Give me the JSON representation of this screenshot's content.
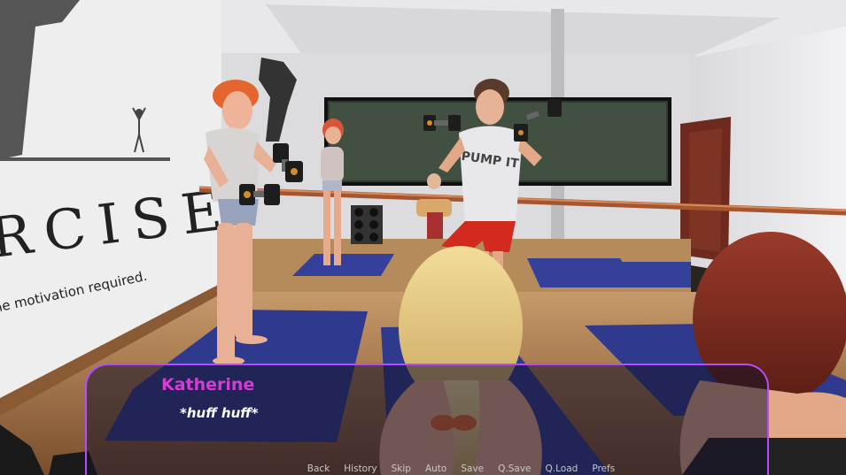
{
  "dialogue": {
    "speaker": "Katherine",
    "text": "*huff huff*"
  },
  "wall_sign": {
    "word": "RCISE",
    "tagline": "he motivation required."
  },
  "shirt_print": "PUMP IT",
  "quick_menu": [
    "Back",
    "History",
    "Skip",
    "Auto",
    "Save",
    "Q.Save",
    "Q.Load",
    "Prefs"
  ],
  "colors": {
    "dialogue_border": "#b44cff",
    "speaker_name": "#d43cd4",
    "dialogue_text": "#ffffff",
    "menu_text": "#c8c8c8"
  }
}
